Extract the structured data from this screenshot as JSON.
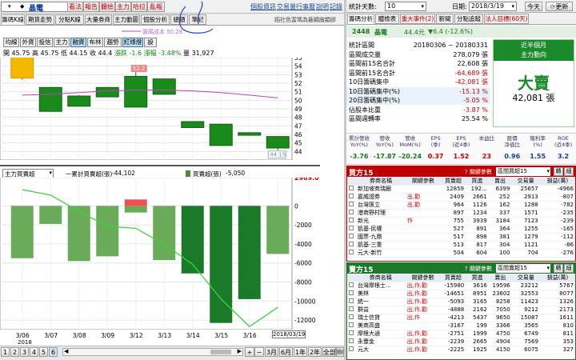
{
  "toolbar": {
    "stock_name": "晶電",
    "buttons": [
      {
        "label": "看法",
        "red": true
      },
      {
        "label": "報告",
        "red": true
      },
      {
        "label": "體檢",
        "red": true
      },
      {
        "label": "主力",
        "red": true
      },
      {
        "label": "哈拉",
        "red": true
      },
      {
        "label": "亂報",
        "red": true
      }
    ],
    "links": [
      "個股資訊",
      "交易量",
      "行事曆",
      "說明",
      "記錄"
    ]
  },
  "stock_tabs": [
    "籌碼K線",
    "期貨走勢",
    "分點K線",
    "大量券商",
    "主力動圖",
    "個股分析",
    "總額",
    "筆記"
  ],
  "slogan": "蹈社色富瑪為藝顯胺顆膠",
  "annotation": "籌碼成本 50.28",
  "sub_tabs": [
    "均線",
    "外資",
    "投信",
    "主力",
    "融資",
    "布林",
    "趨勢",
    "紅綠燈",
    "設"
  ],
  "ohlc": {
    "open_l": "開",
    "open": "45.75",
    "high_l": "高",
    "high": "45.75",
    "low_l": "低",
    "low": "44.15",
    "close_l": "收",
    "close": "44.4",
    "chg_l": "漲跌",
    "chg": "-1.6",
    "pct_l": "漲幅",
    "pct": "-3.48%",
    "vol_l": "量",
    "vol": "31,927"
  },
  "chart_data": [
    {
      "type": "candlestick",
      "x": [
        "3/06",
        "3/07",
        "3/08",
        "3/09",
        "3/12",
        "3/13",
        "3/14",
        "3/15",
        "3/16",
        "3/19"
      ],
      "open": [
        55.6,
        51.5,
        49.3,
        50.4,
        52.8,
        52.5,
        47.5,
        47.2,
        46.2,
        45.75
      ],
      "close": [
        52.6,
        48.7,
        50.5,
        51.5,
        49.2,
        50.7,
        46.8,
        44.7,
        45.9,
        44.4
      ],
      "high": [
        55.6,
        51.5,
        50.6,
        51.5,
        53.3,
        52.5,
        47.5,
        47.2,
        46.2,
        45.75
      ],
      "low": [
        52.4,
        48.7,
        49.3,
        50.4,
        49.2,
        50.7,
        46.8,
        44.7,
        45.9,
        44.15
      ],
      "avg_cost_line": [
        50.6,
        50.7,
        50.9,
        51.1,
        51.2,
        51.2,
        51.1,
        50.9,
        50.6,
        50.28
      ],
      "ylim": [
        43,
        55
      ],
      "ticks": [
        44,
        45,
        46,
        47,
        48,
        49,
        50,
        51,
        52,
        53,
        54,
        55
      ],
      "annotations": [
        "52.2",
        "44.15"
      ]
    },
    {
      "type": "bar",
      "x": [
        "3/06",
        "3/07",
        "3/08",
        "3/09",
        "3/12",
        "3/13",
        "3/14",
        "3/15",
        "3/16",
        "3/19"
      ],
      "values": [
        -5500,
        -1900,
        -5800,
        -5300,
        -700,
        -5700,
        -7100,
        -12300,
        -9800,
        -5050
      ],
      "cumulative": [
        -2300,
        -4200,
        -10000,
        -15300,
        -16000,
        -21700,
        -28800,
        -41100,
        -50900,
        -44102
      ],
      "series_labels": [
        "一累計買賣超(張)",
        "買賣超(張)"
      ],
      "series_values": [
        "-44,102",
        "-5,050"
      ],
      "ylim": [
        -13000,
        2969
      ],
      "ticks": [
        2969.0,
        0,
        -2000,
        -4000,
        -6000,
        -8000,
        -10000,
        -12000
      ],
      "selector": "主力買賣超",
      "year_label": "2018",
      "date_badge": "2018/03/19"
    }
  ],
  "bottom_bar": {
    "nums": [
      "1",
      "2",
      "3",
      "4",
      "5",
      "6"
    ],
    "right": [
      "3月",
      "6月",
      "1年",
      "2年",
      "全部",
      "圖庫"
    ]
  },
  "right": {
    "header": {
      "filter_label": "統計天數:",
      "filter_val": "10",
      "date_label": "日期:",
      "date_val": "2018/3/19",
      "today": "今天",
      "refresh": "更新"
    },
    "tabs": [
      {
        "label": "籌碼分析",
        "red": false
      },
      {
        "label": "體檢表",
        "red": false
      },
      {
        "label": "重大事件(2)",
        "red": true
      },
      {
        "label": "新聞",
        "red": false
      },
      {
        "label": "分點追蹤",
        "red": false
      },
      {
        "label": "法人目標(60天)",
        "red": true
      }
    ],
    "quote": {
      "code": "2448",
      "name": "晶電",
      "price": "44.4元",
      "chg": "▼6.4 (-12.6%)"
    },
    "stats": [
      {
        "k": "統計區間",
        "v": "20180306 ~ 20180331"
      },
      {
        "k": "區間成交量",
        "v": "278,079 張"
      },
      {
        "k": "區間前15名合計",
        "v": "22,608 張"
      },
      {
        "k": "區間前15名合計",
        "v": "-64,689 張"
      },
      {
        "k": "10日籌碼集中",
        "v": "-42,081 張"
      },
      {
        "k": "10日籌碼集中(%)",
        "v": "-15.13 %"
      },
      {
        "k": "20日籌碼集中(%)",
        "v": "-5.05 %"
      },
      {
        "k": "佔股本比重",
        "v": "-3.87 %"
      },
      {
        "k": "區間週轉率",
        "v": "25.54 %"
      }
    ],
    "sell_box": {
      "line1": "近半個月",
      "line2": "主力動向",
      "big": "大賣",
      "amount": "42,081 張"
    },
    "fin_heads": [
      "累計營收\nYoY(%)",
      "營收\nYoY(%)",
      "營收\nMoM(%)",
      "EPS\n(季)",
      "EPS\n(近4季)",
      "本益比",
      "股價\n淨值比",
      "殖利率\n(%)",
      "ROE\n(近4季)"
    ],
    "fin_vals": [
      "-3.76",
      "-17.87",
      "-20.24",
      "0.37",
      "1.52",
      "23",
      "0.96",
      "1.55",
      "3.2"
    ],
    "buy": {
      "title": "買方15",
      "hint": "? 關鍵參數",
      "select": "區間買超15",
      "btn1": "轉",
      "btn2": "細",
      "cols": [
        "",
        "券商名稱",
        "關鍵參數",
        "買賣超",
        "買進",
        "賣出",
        "交易量",
        "損益(萬)"
      ],
      "rows": [
        [
          "新加坡商瑞銀",
          "",
          "12859",
          "192...",
          "6399",
          "25657",
          "-4966"
        ],
        [
          "嘉威證券",
          "出,勸",
          "2409",
          "2661",
          "252",
          "2913",
          "-807"
        ],
        [
          "台灣匯立",
          "出,勸",
          "964",
          "1126",
          "162",
          "1288",
          "-782"
        ],
        [
          "港商野村理",
          "",
          "897",
          "1234",
          "337",
          "1571",
          "-235"
        ],
        [
          "新光",
          "作",
          "755",
          "3939",
          "3184",
          "7123",
          "-239"
        ],
        [
          "凱基-民權",
          "",
          "527",
          "891",
          "364",
          "1255",
          "-165"
        ],
        [
          "國票-九鼎",
          "",
          "517",
          "898",
          "381",
          "1279",
          "-112"
        ],
        [
          "凱基-三重",
          "",
          "513",
          "817",
          "304",
          "1121",
          "-86"
        ],
        [
          "元大-新竹",
          "",
          "504",
          "604",
          "100",
          "704",
          "-276"
        ]
      ]
    },
    "sell": {
      "title": "賣方15",
      "hint": "? 關鍵參數",
      "select": "區間賣超15",
      "btn1": "轉",
      "btn2": "細",
      "cols": [
        "",
        "券商名稱",
        "關鍵參數",
        "買賣超",
        "買進",
        "賣出",
        "交易量",
        "損益(萬)"
      ],
      "rows": [
        [
          "台灣摩根士...",
          "出,作,勸",
          "-15980",
          "3616",
          "19596",
          "23212",
          "5767"
        ],
        [
          "美林",
          "出,作,勸",
          "-14651",
          "8951",
          "23602",
          "32553",
          "8077"
        ],
        [
          "統一",
          "出,作,勸",
          "-5093",
          "3165",
          "8258",
          "11423",
          "1326"
        ],
        [
          "群益",
          "出,作,勸",
          "-4888",
          "2162",
          "7050",
          "9212",
          "2173"
        ],
        [
          "瑞士信貸",
          "出,作",
          "-4213",
          "5437",
          "9650",
          "15087",
          "1611"
        ],
        [
          "美商高盛",
          "",
          "-3167",
          "199",
          "3366",
          "3565",
          "810"
        ],
        [
          "摩根大通",
          "出,作,勸",
          "-2751",
          "1999",
          "4750",
          "6749",
          "811"
        ],
        [
          "永豐金",
          "出,作,勸",
          "-2239",
          "2665",
          "4904",
          "7569",
          "353"
        ],
        [
          "元大",
          "出,作,勸",
          "-2225",
          "1925",
          "4150",
          "6075",
          "327"
        ]
      ]
    }
  }
}
